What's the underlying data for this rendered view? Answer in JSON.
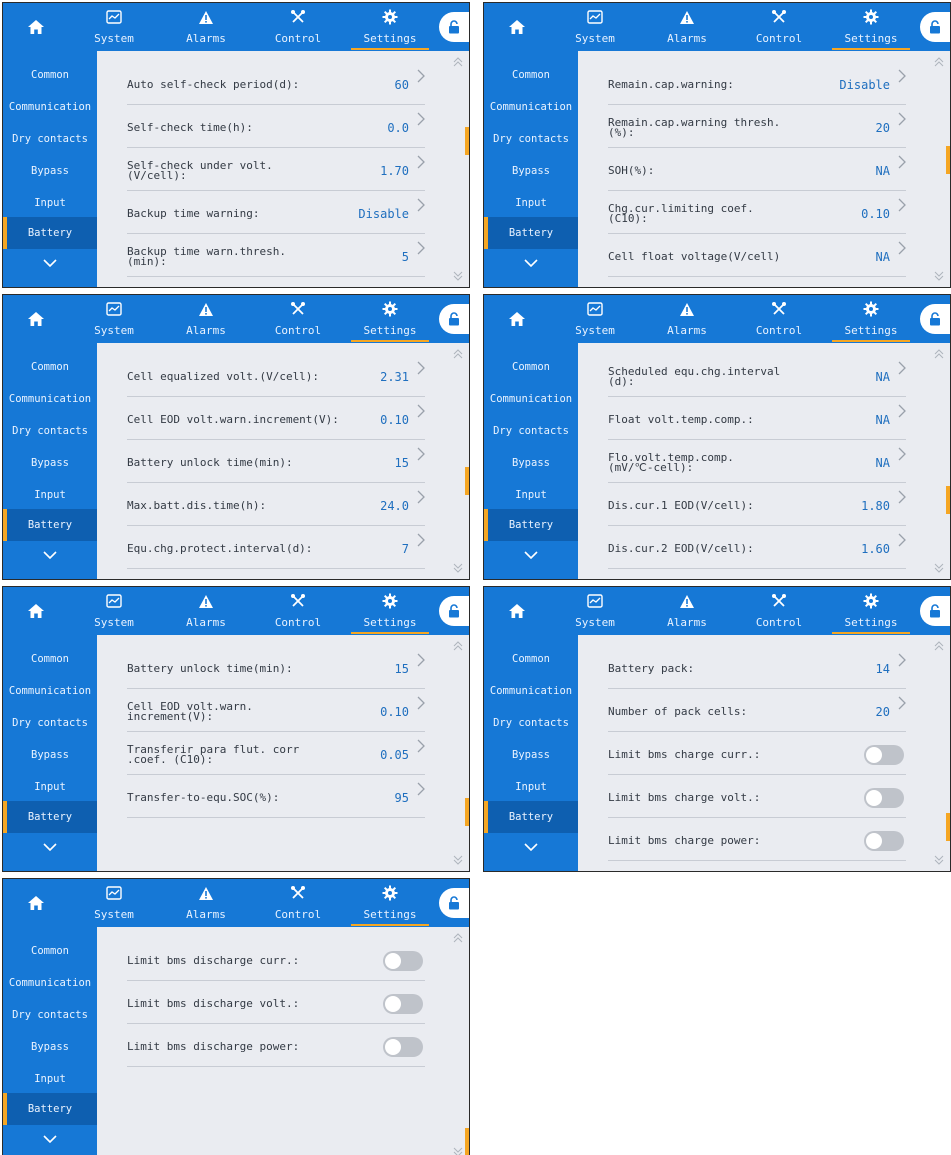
{
  "nav": {
    "tabs": [
      {
        "label": "System",
        "icon": "system-chart-icon"
      },
      {
        "label": "Alarms",
        "icon": "warning-icon"
      },
      {
        "label": "Control",
        "icon": "tools-icon"
      },
      {
        "label": "Settings",
        "icon": "gear-icon"
      }
    ],
    "active_tab": "Settings",
    "home_icon": "home-icon",
    "lock_icon": "unlock-icon"
  },
  "sidebar": {
    "items": [
      "Common",
      "Communication",
      "Dry contacts",
      "Bypass",
      "Input",
      "Battery"
    ],
    "active": "Battery",
    "more_icon": "chevron-down-icon"
  },
  "colors": {
    "primary": "#1678d6",
    "active_item": "#0e5fb0",
    "accent": "#f5a623",
    "value_text": "#1f6fbf",
    "content_bg": "#eaecf1"
  },
  "screens": [
    {
      "rows": [
        {
          "label": "Auto self-check period(d):",
          "value": "60"
        },
        {
          "label": "Self-check time(h):",
          "value": "0.0"
        },
        {
          "label": "Self-check under volt.\n(V/cell):",
          "value": "1.70"
        },
        {
          "label": "Backup time warning:",
          "value": "Disable"
        },
        {
          "label": "Backup time warn.thresh.\n(min):",
          "value": "5"
        }
      ],
      "scroll_fraction": 0.35
    },
    {
      "rows": [
        {
          "label": "Remain.cap.warning:",
          "value": "Disable"
        },
        {
          "label": "Remain.cap.warning thresh.\n(%):",
          "value": "20"
        },
        {
          "label": "SOH(%):",
          "value": "NA"
        },
        {
          "label": "Chg.cur.limiting coef.\n(C10):",
          "value": "0.10"
        },
        {
          "label": "Cell float voltage(V/cell)",
          "value": "NA"
        }
      ],
      "scroll_fraction": 0.45
    },
    {
      "rows": [
        {
          "label": "Cell equalized volt.(V/cell):",
          "value": "2.31"
        },
        {
          "label": "Cell EOD volt.warn.increment(V):",
          "value": "0.10"
        },
        {
          "label": "Battery unlock time(min):",
          "value": "15"
        },
        {
          "label": "Max.batt.dis.time(h):",
          "value": "24.0"
        },
        {
          "label": "Equ.chg.protect.interval(d):",
          "value": "7"
        }
      ],
      "scroll_fraction": 0.6
    },
    {
      "rows": [
        {
          "label": "Scheduled equ.chg.interval\n(d):",
          "value": "NA"
        },
        {
          "label": "Float volt.temp.comp.:",
          "value": "NA"
        },
        {
          "label": "Flo.volt.temp.comp.\n(mV/℃-cell):",
          "value": "NA"
        },
        {
          "label": "Dis.cur.1 EOD(V/cell):",
          "value": "1.80"
        },
        {
          "label": "Dis.cur.2 EOD(V/cell):",
          "value": "1.60"
        }
      ],
      "scroll_fraction": 0.7
    },
    {
      "rows": [
        {
          "label": "Battery unlock time(min):",
          "value": "15"
        },
        {
          "label": "Cell EOD volt.warn.\nincrement(V):",
          "value": "0.10"
        },
        {
          "label": "Transferir para flut. corr\n.coef. (C10):",
          "value": "0.05"
        },
        {
          "label": "Transfer-to-equ.SOC(%):",
          "value": "95"
        }
      ],
      "scroll_fraction": 0.8
    },
    {
      "rows": [
        {
          "label": "Battery pack:",
          "value": "14"
        },
        {
          "label": "Number of pack cells:",
          "value": "20"
        },
        {
          "label": "Limit bms charge curr.:",
          "toggle": false
        },
        {
          "label": "Limit bms charge volt.:",
          "toggle": false
        },
        {
          "label": "Limit bms charge power:",
          "toggle": false
        }
      ],
      "scroll_fraction": 0.88
    },
    {
      "rows": [
        {
          "label": "Limit bms discharge curr.:",
          "toggle": false
        },
        {
          "label": "Limit bms discharge volt.:",
          "toggle": false
        },
        {
          "label": "Limit bms discharge power:",
          "toggle": false
        }
      ],
      "scroll_fraction": 1.0
    }
  ]
}
